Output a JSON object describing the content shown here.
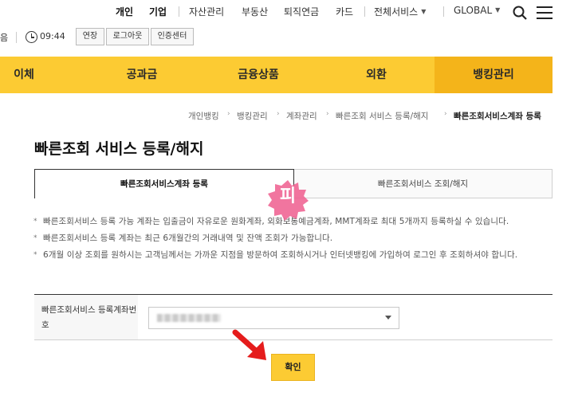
{
  "topnav": {
    "personal": "개인",
    "corporate": "기업",
    "asset": "자산관리",
    "realestate": "부동산",
    "pension": "퇴직연금",
    "card": "카드",
    "all_services": "전체서비스",
    "global": "GLOBAL"
  },
  "session": {
    "cut_text": "음",
    "time": "09:44",
    "extend": "연장",
    "logout": "로그아웃",
    "cert_center": "인증센터"
  },
  "gnb": {
    "items": [
      "이체",
      "공과금",
      "금융상품",
      "외환",
      "뱅킹관리"
    ],
    "active_color": "#f4b41a",
    "bg_color": "#fccb33"
  },
  "breadcrumb": [
    "개인뱅킹",
    "뱅킹관리",
    "계좌관리",
    "빠른조회 서비스 등록/해지",
    "빠른조회서비스계좌 등록"
  ],
  "page": {
    "title": "빠른조회 서비스 등록/해지"
  },
  "tabs": {
    "register": "빠른조회서비스계좌 등록",
    "inquiry": "빠른조회서비스 조회/해지"
  },
  "notices": {
    "star": "*",
    "line1": "빠른조회서비스 등록 가능 계좌는 입출금이 자유로운 원화계좌, 외화보통예금계좌, MMT계좌로 최대 5개까지 등록하실 수 있습니다.",
    "line2": "빠른조회서비스 등록 계좌는 최근 6개월간의 거래내역 및 잔액 조회가 가능합니다.",
    "line3": "6개월 이상 조회를 원하시는 고객님께서는 가까운 지점을 방문하여 조회하시거나 인터넷뱅킹에 가입하여 로그인 후 조회하셔야 합니다."
  },
  "form": {
    "label": "빠른조회서비스 등록계좌번호"
  },
  "actions": {
    "confirm": "확인"
  },
  "watermark": {
    "text": "피",
    "color": "#f06292"
  },
  "annotation": {
    "arrow_color": "#e51c1c"
  }
}
